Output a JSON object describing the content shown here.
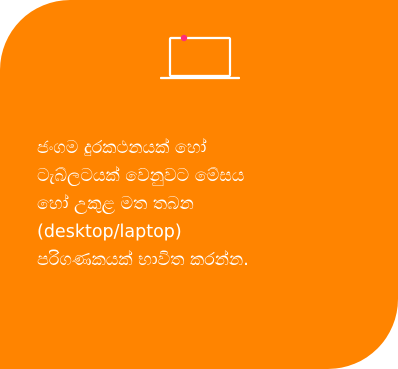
{
  "card": {
    "background_color": "#FF8400",
    "icon": "laptop-icon",
    "icon_accent_color": "#FF2D7A",
    "message_lines": [
      "ජංගම දුරකථනයක් හෝ",
      "ටැබ්ලටයක් වෙනුවට මේසය",
      "හෝ උකුළ මත තබන",
      "(desktop/laptop)",
      "පරිගණකයක් භාවිත කරන්න."
    ]
  }
}
